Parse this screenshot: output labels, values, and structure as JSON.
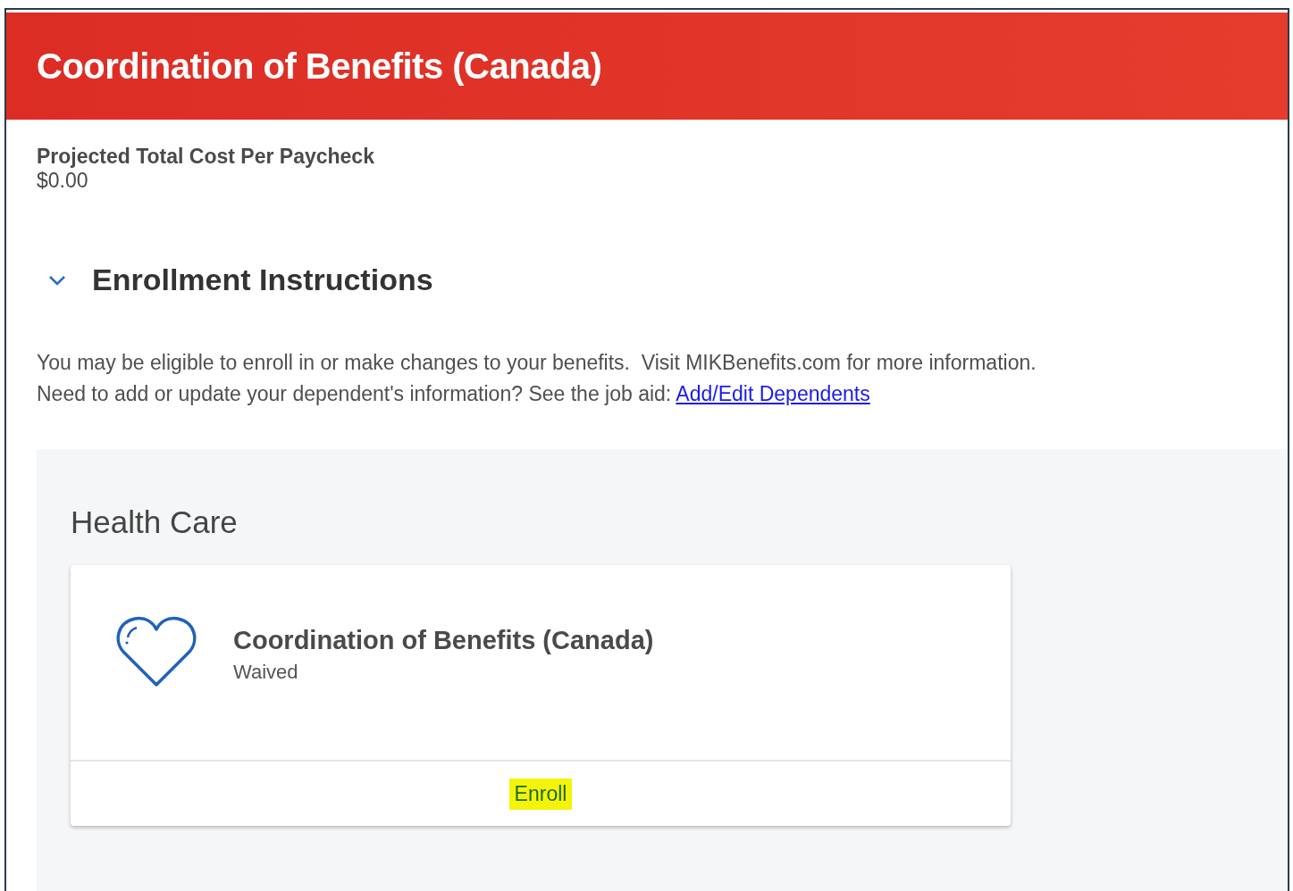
{
  "header": {
    "title": "Coordination of Benefits (Canada)"
  },
  "cost": {
    "label": "Projected Total Cost Per Paycheck",
    "value": "$0.00"
  },
  "section": {
    "title": "Enrollment Instructions",
    "expanded": true,
    "lines": [
      {
        "text": "You may be eligible to enroll in or make changes to your benefits.  Visit MIKBenefits.com for more information."
      },
      {
        "text": "Need to add or update your dependent's information? See the job aid: ",
        "link": "Add/Edit Dependents"
      }
    ]
  },
  "group": {
    "title": "Health Care",
    "cards": [
      {
        "title": "Coordination of Benefits (Canada)",
        "status": "Waived",
        "action": "Enroll",
        "highlighted": true
      }
    ]
  }
}
